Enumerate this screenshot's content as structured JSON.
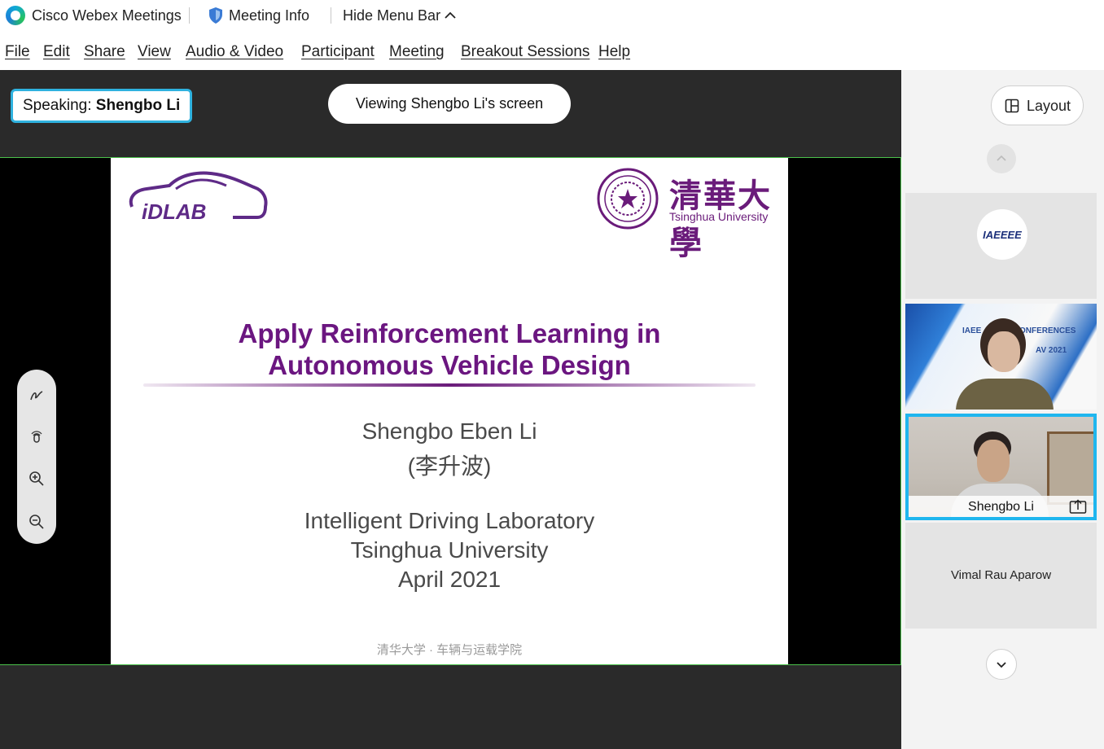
{
  "titlebar": {
    "app_name": "Cisco Webex Meetings",
    "meeting_info": "Meeting Info",
    "hide_menu_bar": "Hide Menu Bar"
  },
  "menu": [
    "File",
    "Edit",
    "Share",
    "View",
    "Audio & Video",
    "Participant",
    "Meeting",
    "Breakout Sessions",
    "Help"
  ],
  "stage": {
    "speaking_label": "Speaking:",
    "speaking_name": "Shengbo Li",
    "viewing_label": "Viewing Shengbo Li's screen"
  },
  "slide": {
    "lab_logo_text": "iDLAB",
    "university_cn": "清華大學",
    "university_en": "Tsinghua University",
    "title_line1": "Apply Reinforcement Learning in",
    "title_line2": "Autonomous Vehicle Design",
    "author": "Shengbo Eben Li",
    "author_cn": "(李升波)",
    "affiliation1": "Intelligent Driving Laboratory",
    "affiliation2": "Tsinghua University",
    "date": "April 2021",
    "footer": "清华大学 · 车辆与运载学院"
  },
  "annotation_tools": [
    "pen-icon",
    "pointer-icon",
    "zoom-in-icon",
    "zoom-out-icon"
  ],
  "side": {
    "layout_label": "Layout",
    "participants": [
      {
        "logo_text": "IAEEEE"
      },
      {
        "banner_left": "IAEE",
        "banner_right": "ONFERENCES",
        "banner_sub": "AV 2021"
      },
      {
        "name": "Shengbo Li"
      },
      {
        "name": "Vimal Rau Aparow"
      }
    ]
  },
  "colors": {
    "active_border": "#1fb6ee",
    "slide_purple": "#6b1680",
    "share_border": "#4bc14b"
  }
}
